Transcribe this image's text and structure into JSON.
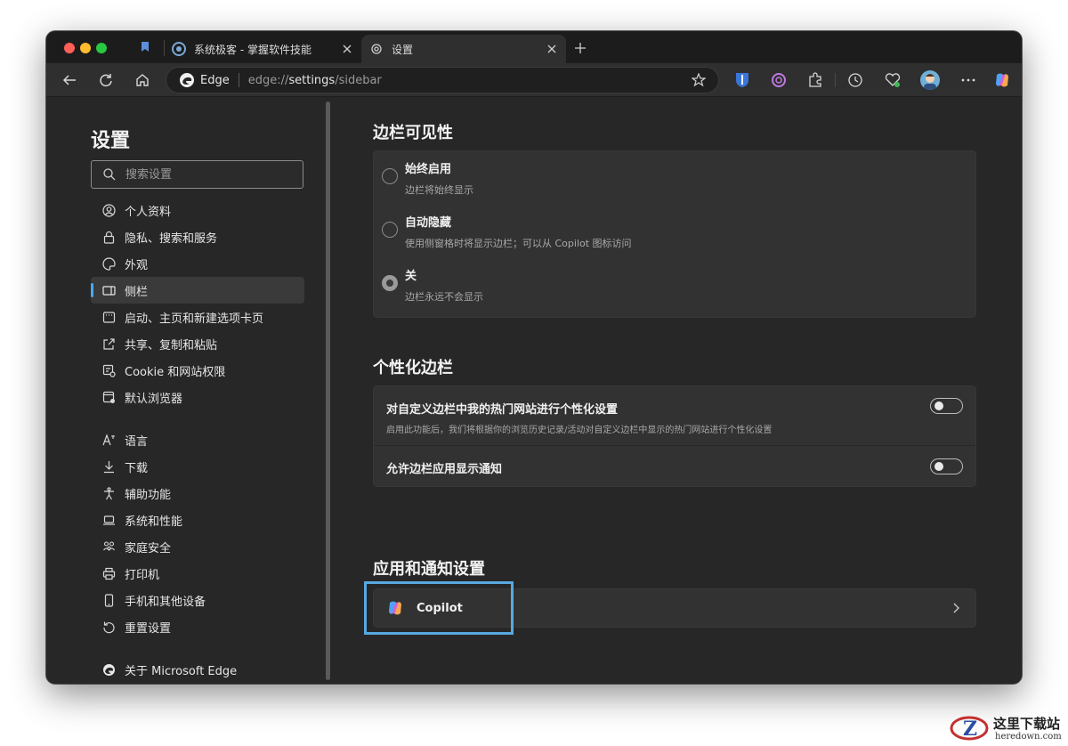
{
  "tabs": [
    {
      "title": "系统极客 - 掌握软件技能",
      "icon": "syst-geek-icon"
    },
    {
      "title": "设置",
      "icon": "gear-icon"
    }
  ],
  "toolbar": {
    "brand": "Edge",
    "url_prefix": "edge://",
    "url_highlight": "settings",
    "url_suffix": "/sidebar"
  },
  "sidebar": {
    "title": "设置",
    "search_placeholder": "搜索设置",
    "items": [
      {
        "label": "个人资料",
        "icon": "profile-icon"
      },
      {
        "label": "隐私、搜索和服务",
        "icon": "lock-icon"
      },
      {
        "label": "外观",
        "icon": "palette-icon"
      },
      {
        "label": "侧栏",
        "icon": "sidebar-icon",
        "active": true
      },
      {
        "label": "启动、主页和新建选项卡页",
        "icon": "home-page-icon"
      },
      {
        "label": "共享、复制和粘贴",
        "icon": "share-icon"
      },
      {
        "label": "Cookie 和网站权限",
        "icon": "cookie-icon"
      },
      {
        "label": "默认浏览器",
        "icon": "browser-icon"
      },
      {
        "label": "语言",
        "icon": "language-icon"
      },
      {
        "label": "下载",
        "icon": "download-icon"
      },
      {
        "label": "辅助功能",
        "icon": "accessibility-icon"
      },
      {
        "label": "系统和性能",
        "icon": "laptop-icon"
      },
      {
        "label": "家庭安全",
        "icon": "family-icon"
      },
      {
        "label": "打印机",
        "icon": "printer-icon"
      },
      {
        "label": "手机和其他设备",
        "icon": "phone-icon"
      },
      {
        "label": "重置设置",
        "icon": "reset-icon"
      },
      {
        "label": "关于 Microsoft Edge",
        "icon": "edge-logo-icon"
      }
    ]
  },
  "main": {
    "visibility": {
      "title": "边栏可见性",
      "options": [
        {
          "label": "始终启用",
          "desc": "边栏将始终显示",
          "checked": false
        },
        {
          "label": "自动隐藏",
          "desc": "使用侧窗格时将显示边栏；可以从 Copilot 图标访问",
          "checked": false
        },
        {
          "label": "关",
          "desc": "边栏永远不会显示",
          "checked": true
        }
      ]
    },
    "personalize": {
      "title": "个性化边栏",
      "rows": [
        {
          "label": "对自定义边栏中我的热门网站进行个性化设置",
          "desc": "启用此功能后，我们将根据你的浏览历史记录/活动对自定义边栏中显示的热门网站进行个性化设置",
          "enabled": false
        },
        {
          "label": "允许边栏应用显示通知",
          "desc": "",
          "enabled": false
        }
      ]
    },
    "apps": {
      "title": "应用和通知设置",
      "copilot_label": "Copilot"
    }
  },
  "watermark": {
    "text": "这里下载站",
    "sub": "heredown.com"
  },
  "colors": {
    "accent": "#4aa8f0",
    "highlight_box": "#58a8e0",
    "window_bg": "#272727",
    "card_bg": "#323232"
  }
}
